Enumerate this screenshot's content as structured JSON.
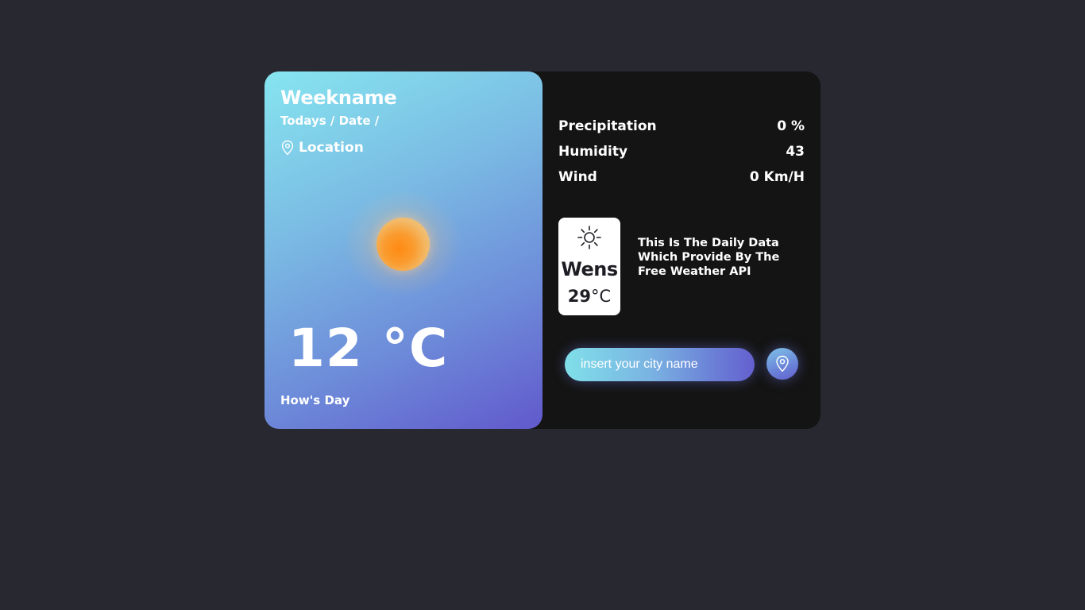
{
  "left_panel": {
    "weekname": "Weekname",
    "date_line": "Todays / Date /",
    "location": "Location",
    "icons": [
      "map-pin-icon",
      "sun-icon"
    ],
    "temperature": "12 °C",
    "description": "How's Day"
  },
  "stats": [
    {
      "label": "Precipitation",
      "value": "0 %"
    },
    {
      "label": "Humidity",
      "value": "43"
    },
    {
      "label": "Wind",
      "value": "0 Km/H"
    }
  ],
  "day_card": {
    "icon": "sun-outline-icon",
    "day": "Wens",
    "temp": "29",
    "unit": "°C"
  },
  "api_note": "This Is The Daily Data Which Provide By The Free Weather API",
  "search": {
    "placeholder": "insert your city name",
    "button_icon": "map-pin-icon"
  },
  "colors": {
    "page_bg": "#282831",
    "card_bg": "#141414",
    "gradient_start": "#86e5ef",
    "gradient_end": "#6159cc",
    "sun": "#ff8a12",
    "text": "#ffffff"
  }
}
